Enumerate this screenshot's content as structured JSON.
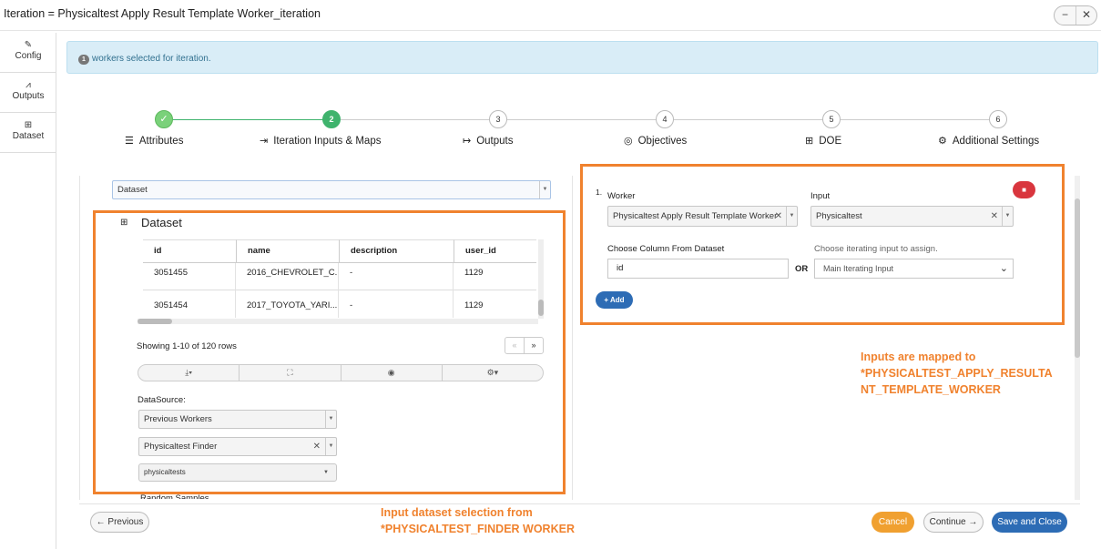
{
  "window": {
    "title": "Iteration = Physicaltest Apply Result Template Worker_iteration",
    "minimize": "−",
    "close": "✕"
  },
  "sidenav": [
    {
      "label": "Config",
      "icon": "edit-icon",
      "glyph": "✎"
    },
    {
      "label": "Outputs",
      "icon": "chart-icon",
      "glyph": "⩘"
    },
    {
      "label": "Dataset",
      "icon": "table-icon",
      "glyph": "⊞"
    }
  ],
  "alert": {
    "count": "1",
    "text": "workers selected for iteration."
  },
  "steps": [
    {
      "num": "✓",
      "label": "Attributes",
      "icon": "list-icon",
      "glyph": "☰",
      "state": "done"
    },
    {
      "num": "2",
      "label": "Iteration Inputs & Maps",
      "icon": "sign-in-icon",
      "glyph": "⇥",
      "state": "active"
    },
    {
      "num": "3",
      "label": "Outputs",
      "icon": "sign-out-icon",
      "glyph": "↦",
      "state": "todo"
    },
    {
      "num": "4",
      "label": "Objectives",
      "icon": "target-icon",
      "glyph": "◎",
      "state": "todo"
    },
    {
      "num": "5",
      "label": "DOE",
      "icon": "table-icon",
      "glyph": "⊞",
      "state": "todo"
    },
    {
      "num": "6",
      "label": "Additional Settings",
      "icon": "gear-icon",
      "glyph": "⚙",
      "state": "todo"
    }
  ],
  "left": {
    "source_select": "Dataset",
    "panel_title": "Dataset",
    "columns": [
      "id",
      "name",
      "description",
      "user_id"
    ],
    "rows": [
      [
        "3051455",
        "2016_CHEVROLET_C...",
        "-",
        "1129"
      ],
      [
        "3051454",
        "2017_TOYOTA_YARI...",
        "-",
        "1129"
      ]
    ],
    "pagination_text": "Showing 1-10 of 120 rows",
    "prev_page": "«",
    "next_page": "»",
    "toolbar": [
      "⤓▾",
      "⛶",
      "◉",
      "⚙▾"
    ],
    "datasource_label": "DataSource:",
    "datasource_type": "Previous Workers",
    "datasource_worker": "Physicaltest Finder",
    "datasource_item": "physicaltests",
    "random_samples": "Random Samples"
  },
  "right": {
    "index": "1.",
    "worker_label": "Worker",
    "worker_value": "Physicaltest Apply Result Template Worker",
    "input_label": "Input",
    "input_value": "Physicaltest",
    "column_label": "Choose Column From Dataset",
    "column_value": "id",
    "or_text": "OR",
    "iter_label": "Choose iterating input to assign.",
    "iter_value": "Main Iterating Input",
    "add_button": "+ Add",
    "delete_glyph": "■"
  },
  "annotations": {
    "inputs_note": [
      "Inputs are mapped to",
      "*PHYSICALTEST_APPLY_RESULTA",
      "NT_TEMPLATE_WORKER"
    ],
    "dataset_note": [
      "Input dataset selection from",
      "*PHYSICALTEST_FINDER WORKER"
    ]
  },
  "footer": {
    "previous": "← Previous",
    "cancel": "Cancel",
    "continue": "Continue →",
    "save": "Save and Close"
  },
  "colors": {
    "accent_orange": "#f0822e",
    "primary_blue": "#2d6cb5",
    "success_green": "#3fb36d",
    "alert_bg": "#d9edf7"
  }
}
